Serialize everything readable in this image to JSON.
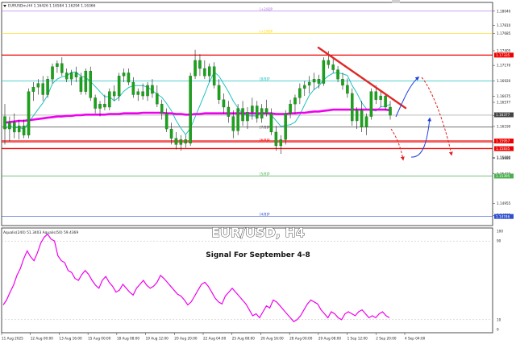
{
  "main_header": "EURUSDm,H4  1.16426  1.16584  1.16294  1.16366",
  "indicator_header": "Aqualis(240) 51.3403  Aqualis(50) 59.4369",
  "overlay_title": "EUR/USD, H4",
  "overlay_subtitle": "Signal For September 4-8",
  "colors": {
    "candle": "#1aa31a",
    "ema": "#ee00ee",
    "bollinger": "#20c0c0",
    "red_lines": "#ee0000",
    "trendline": "#e02828",
    "yellow": "#ffd700",
    "purple_top": "#b070e0",
    "green_line": "#4caf50",
    "blue_line": "#3050d0",
    "oscillator": "#ee00ee",
    "arrow_blue": "#2040e0",
    "arrow_red": "#e02020"
  },
  "price_axis_labels": [
    "1.18040",
    "1.17810",
    "1.17685",
    "1.17405",
    "1.17170",
    "1.16920",
    "1.16675",
    "1.16577",
    "1.16366",
    "1.16190",
    "1.15940",
    "1.15680",
    "1.15690",
    "1.15430",
    "1.14955",
    "1.14765"
  ],
  "price_tags": {
    "1.17335": "#ee0000",
    "1.15957": "#ee0000",
    "1.15835": "#ee0000",
    "1.15395": "#4caf50",
    "1.14746": "#3050d0",
    "1.16377": "#444444"
  },
  "levels": [
    {
      "price": 1.1804,
      "label": "[+2/8]P",
      "color": "#b070e0"
    },
    {
      "price": 1.17685,
      "label": "[+1/8]P",
      "color": "#ffd700"
    },
    {
      "price": 1.1692,
      "label": "[8/8]P",
      "color": "#20c0c0"
    },
    {
      "price": 1.1618,
      "label": "[7/8]P",
      "color": "#444444"
    },
    {
      "price": 1.1594,
      "label": "[6/8]P",
      "color": "#ee0000"
    },
    {
      "price": 1.15395,
      "label": "[5/8]P",
      "color": "#4caf50"
    },
    {
      "price": 1.14746,
      "label": "[4/8]P",
      "color": "#3050d0"
    }
  ],
  "osc_axis_labels": [
    "100",
    "90",
    "10",
    "0"
  ],
  "time_labels": [
    "11 Aug 2025",
    "12 Aug 00:00",
    "13 Aug 16:00",
    "15 Aug 00:00",
    "18 Aug 08:00",
    "19 Aug 12:00",
    "20 Aug 20:00",
    "22 Aug 04:00",
    "25 Aug 08:00",
    "26 Aug 16:00",
    "28 Aug 00:00",
    "29 Aug 08:00",
    "1 Sep 12:00",
    "2 Sep 20:00",
    "4 Sep 04:00"
  ],
  "chart_data": {
    "type": "candlestick",
    "symbol": "EURUSDm",
    "timeframe": "H4",
    "ylim": [
      1.146,
      1.1818
    ],
    "horizontal_lines": [
      1.17335,
      1.15957,
      1.15835
    ],
    "trendline": {
      "from": [
        1.17455,
        0
      ],
      "to": [
        1.16486,
        1
      ]
    },
    "candles": [
      {
        "o": 1.1635,
        "h": 1.1655,
        "l": 1.159,
        "c": 1.1615
      },
      {
        "o": 1.1615,
        "h": 1.1635,
        "l": 1.1595,
        "c": 1.1625
      },
      {
        "o": 1.1625,
        "h": 1.164,
        "l": 1.16,
        "c": 1.161
      },
      {
        "o": 1.161,
        "h": 1.163,
        "l": 1.1598,
        "c": 1.162
      },
      {
        "o": 1.162,
        "h": 1.163,
        "l": 1.16,
        "c": 1.1605
      },
      {
        "o": 1.1605,
        "h": 1.168,
        "l": 1.16,
        "c": 1.1675
      },
      {
        "o": 1.1675,
        "h": 1.169,
        "l": 1.166,
        "c": 1.1682
      },
      {
        "o": 1.1682,
        "h": 1.1695,
        "l": 1.167,
        "c": 1.1688
      },
      {
        "o": 1.1688,
        "h": 1.17,
        "l": 1.166,
        "c": 1.167
      },
      {
        "o": 1.167,
        "h": 1.17,
        "l": 1.1665,
        "c": 1.1695
      },
      {
        "o": 1.1695,
        "h": 1.172,
        "l": 1.1688,
        "c": 1.1715
      },
      {
        "o": 1.1715,
        "h": 1.1725,
        "l": 1.1705,
        "c": 1.172
      },
      {
        "o": 1.172,
        "h": 1.173,
        "l": 1.17,
        "c": 1.1705
      },
      {
        "o": 1.1705,
        "h": 1.1712,
        "l": 1.169,
        "c": 1.1695
      },
      {
        "o": 1.1695,
        "h": 1.171,
        "l": 1.1685,
        "c": 1.1705
      },
      {
        "o": 1.1705,
        "h": 1.1715,
        "l": 1.169,
        "c": 1.1698
      },
      {
        "o": 1.1698,
        "h": 1.1705,
        "l": 1.167,
        "c": 1.1675
      },
      {
        "o": 1.1675,
        "h": 1.1712,
        "l": 1.167,
        "c": 1.1708
      },
      {
        "o": 1.1708,
        "h": 1.1715,
        "l": 1.166,
        "c": 1.1665
      },
      {
        "o": 1.1665,
        "h": 1.167,
        "l": 1.164,
        "c": 1.1648
      },
      {
        "o": 1.1648,
        "h": 1.166,
        "l": 1.1635,
        "c": 1.1655
      },
      {
        "o": 1.1655,
        "h": 1.167,
        "l": 1.1645,
        "c": 1.165
      },
      {
        "o": 1.165,
        "h": 1.168,
        "l": 1.1645,
        "c": 1.1675
      },
      {
        "o": 1.1675,
        "h": 1.1685,
        "l": 1.166,
        "c": 1.1668
      },
      {
        "o": 1.1668,
        "h": 1.1705,
        "l": 1.166,
        "c": 1.17
      },
      {
        "o": 1.17,
        "h": 1.1712,
        "l": 1.169,
        "c": 1.1705
      },
      {
        "o": 1.1705,
        "h": 1.1712,
        "l": 1.1685,
        "c": 1.169
      },
      {
        "o": 1.169,
        "h": 1.1698,
        "l": 1.1665,
        "c": 1.167
      },
      {
        "o": 1.167,
        "h": 1.168,
        "l": 1.166,
        "c": 1.1675
      },
      {
        "o": 1.1675,
        "h": 1.1688,
        "l": 1.1662,
        "c": 1.1668
      },
      {
        "o": 1.1668,
        "h": 1.169,
        "l": 1.166,
        "c": 1.1685
      },
      {
        "o": 1.1685,
        "h": 1.1695,
        "l": 1.1665,
        "c": 1.1672
      },
      {
        "o": 1.1672,
        "h": 1.1685,
        "l": 1.165,
        "c": 1.1655
      },
      {
        "o": 1.1655,
        "h": 1.1662,
        "l": 1.163,
        "c": 1.164
      },
      {
        "o": 1.164,
        "h": 1.1648,
        "l": 1.161,
        "c": 1.1615
      },
      {
        "o": 1.1615,
        "h": 1.1625,
        "l": 1.159,
        "c": 1.16
      },
      {
        "o": 1.16,
        "h": 1.161,
        "l": 1.1582,
        "c": 1.159
      },
      {
        "o": 1.159,
        "h": 1.1605,
        "l": 1.158,
        "c": 1.1598
      },
      {
        "o": 1.1598,
        "h": 1.1605,
        "l": 1.1585,
        "c": 1.1592
      },
      {
        "o": 1.1592,
        "h": 1.1705,
        "l": 1.1588,
        "c": 1.17
      },
      {
        "o": 1.17,
        "h": 1.1742,
        "l": 1.1695,
        "c": 1.1725
      },
      {
        "o": 1.1725,
        "h": 1.1735,
        "l": 1.17,
        "c": 1.1712
      },
      {
        "o": 1.1712,
        "h": 1.1725,
        "l": 1.1695,
        "c": 1.17
      },
      {
        "o": 1.17,
        "h": 1.172,
        "l": 1.169,
        "c": 1.1715
      },
      {
        "o": 1.1715,
        "h": 1.1722,
        "l": 1.168,
        "c": 1.1685
      },
      {
        "o": 1.1685,
        "h": 1.1695,
        "l": 1.1655,
        "c": 1.1662
      },
      {
        "o": 1.1662,
        "h": 1.1672,
        "l": 1.164,
        "c": 1.165
      },
      {
        "o": 1.165,
        "h": 1.166,
        "l": 1.1625,
        "c": 1.1635
      },
      {
        "o": 1.1635,
        "h": 1.1645,
        "l": 1.16,
        "c": 1.1612
      },
      {
        "o": 1.1612,
        "h": 1.1655,
        "l": 1.1605,
        "c": 1.1648
      },
      {
        "o": 1.1648,
        "h": 1.166,
        "l": 1.162,
        "c": 1.1628
      },
      {
        "o": 1.1628,
        "h": 1.165,
        "l": 1.1615,
        "c": 1.1642
      },
      {
        "o": 1.1642,
        "h": 1.1665,
        "l": 1.163,
        "c": 1.1652
      },
      {
        "o": 1.1652,
        "h": 1.166,
        "l": 1.1625,
        "c": 1.1632
      },
      {
        "o": 1.1632,
        "h": 1.1655,
        "l": 1.1625,
        "c": 1.1648
      },
      {
        "o": 1.1648,
        "h": 1.1662,
        "l": 1.1635,
        "c": 1.164
      },
      {
        "o": 1.164,
        "h": 1.1648,
        "l": 1.1605,
        "c": 1.161
      },
      {
        "o": 1.161,
        "h": 1.162,
        "l": 1.158,
        "c": 1.1588
      },
      {
        "o": 1.1588,
        "h": 1.1605,
        "l": 1.1575,
        "c": 1.1598
      },
      {
        "o": 1.1598,
        "h": 1.1645,
        "l": 1.159,
        "c": 1.164
      },
      {
        "o": 1.164,
        "h": 1.1662,
        "l": 1.1632,
        "c": 1.1655
      },
      {
        "o": 1.1655,
        "h": 1.167,
        "l": 1.164,
        "c": 1.1665
      },
      {
        "o": 1.1665,
        "h": 1.1688,
        "l": 1.1655,
        "c": 1.168
      },
      {
        "o": 1.168,
        "h": 1.1692,
        "l": 1.1668,
        "c": 1.1685
      },
      {
        "o": 1.1685,
        "h": 1.17,
        "l": 1.1672,
        "c": 1.169
      },
      {
        "o": 1.169,
        "h": 1.1705,
        "l": 1.1678,
        "c": 1.1695
      },
      {
        "o": 1.1695,
        "h": 1.1702,
        "l": 1.168,
        "c": 1.1688
      },
      {
        "o": 1.1688,
        "h": 1.173,
        "l": 1.1684,
        "c": 1.1725
      },
      {
        "o": 1.1725,
        "h": 1.174,
        "l": 1.1712,
        "c": 1.1718
      },
      {
        "o": 1.1718,
        "h": 1.173,
        "l": 1.1705,
        "c": 1.171
      },
      {
        "o": 1.171,
        "h": 1.1716,
        "l": 1.169,
        "c": 1.1695
      },
      {
        "o": 1.1695,
        "h": 1.1705,
        "l": 1.1678,
        "c": 1.1685
      },
      {
        "o": 1.1685,
        "h": 1.1696,
        "l": 1.1665,
        "c": 1.1672
      },
      {
        "o": 1.1672,
        "h": 1.168,
        "l": 1.162,
        "c": 1.1628
      },
      {
        "o": 1.1628,
        "h": 1.165,
        "l": 1.1615,
        "c": 1.1645
      },
      {
        "o": 1.1645,
        "h": 1.166,
        "l": 1.161,
        "c": 1.1618
      },
      {
        "o": 1.1618,
        "h": 1.164,
        "l": 1.1605,
        "c": 1.1635
      },
      {
        "o": 1.1635,
        "h": 1.168,
        "l": 1.163,
        "c": 1.1675
      },
      {
        "o": 1.1675,
        "h": 1.1685,
        "l": 1.1655,
        "c": 1.1662
      },
      {
        "o": 1.1662,
        "h": 1.1675,
        "l": 1.165,
        "c": 1.1668
      },
      {
        "o": 1.1668,
        "h": 1.1672,
        "l": 1.1645,
        "c": 1.165
      },
      {
        "o": 1.165,
        "h": 1.166,
        "l": 1.163,
        "c": 1.1637
      }
    ],
    "ema_200": [
      1.1625,
      1.1626,
      1.1627,
      1.1628,
      1.1628,
      1.1629,
      1.163,
      1.1631,
      1.1632,
      1.1633,
      1.1634,
      1.1635,
      1.1635,
      1.1636,
      1.1636,
      1.1637,
      1.1637,
      1.1638,
      1.1638,
      1.1638,
      1.1638,
      1.1638,
      1.1639,
      1.1639,
      1.1639,
      1.164,
      1.164,
      1.164,
      1.164,
      1.1641,
      1.1641,
      1.1641,
      1.1641,
      1.1641,
      1.164,
      1.164,
      1.1639,
      1.1639,
      1.1638,
      1.1638,
      1.1639,
      1.1639,
      1.164,
      1.164,
      1.164,
      1.164,
      1.164,
      1.164,
      1.164,
      1.164,
      1.164,
      1.164,
      1.164,
      1.164,
      1.164,
      1.164,
      1.164,
      1.1639,
      1.1639,
      1.1639,
      1.164,
      1.164,
      1.1641,
      1.1641,
      1.1642,
      1.1643,
      1.1643,
      1.1644,
      1.1645,
      1.1646,
      1.1646,
      1.1646,
      1.1646,
      1.1646,
      1.1646,
      1.1646,
      1.1646,
      1.1646,
      1.1646,
      1.1646,
      1.1646,
      1.1645
    ],
    "oscillator": {
      "name": "Aqualis",
      "ylim": [
        0,
        100
      ],
      "levels": [
        10,
        90
      ],
      "values": [
        25,
        30,
        38,
        45,
        55,
        62,
        72,
        80,
        74,
        70,
        78,
        88,
        94,
        97,
        92,
        90,
        75,
        70,
        68,
        60,
        58,
        52,
        50,
        56,
        60,
        56,
        50,
        45,
        42,
        50,
        54,
        48,
        44,
        38,
        40,
        46,
        42,
        38,
        35,
        42,
        46,
        50,
        45,
        42,
        44,
        48,
        55,
        52,
        48,
        44,
        40,
        36,
        34,
        30,
        25,
        28,
        34,
        40,
        46,
        48,
        44,
        38,
        32,
        28,
        26,
        34,
        38,
        42,
        38,
        34,
        30,
        26,
        20,
        14,
        16,
        12,
        18,
        24,
        22,
        30,
        28,
        24,
        20,
        16,
        12,
        8,
        10,
        14,
        20,
        26,
        30,
        28,
        26,
        20,
        16,
        12,
        18,
        16,
        12,
        10,
        16,
        18,
        16,
        14,
        18,
        20,
        16,
        12,
        14,
        12,
        16,
        18,
        14,
        12
      ]
    }
  }
}
